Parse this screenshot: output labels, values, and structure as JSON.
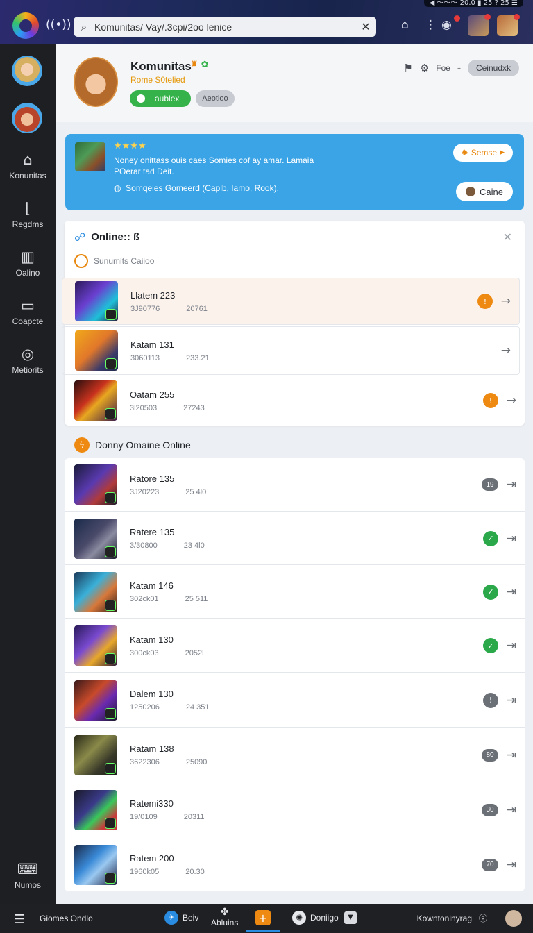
{
  "topbar": {
    "status_text": "◀ 〜〜〜 20.0  ▮  25 ? 25 ☰",
    "search_placeholder": "Komunitas/ Vay/.3cpi/2oo lenice",
    "search_value": "Komunitas/ Vay/.3cpi/2oo lenice"
  },
  "rail": {
    "items": [
      {
        "label": "Konunitas",
        "icon": "home-icon"
      },
      {
        "label": "Regdms",
        "icon": "chart-icon"
      },
      {
        "label": "Oalino",
        "icon": "grid-icon"
      },
      {
        "label": "Coapcte",
        "icon": "calendar-icon"
      },
      {
        "label": "Metiorits",
        "icon": "target-icon"
      }
    ],
    "bottom_label": "Numos"
  },
  "profile": {
    "name": "Komunitas",
    "subtitle": "Rome S0telied",
    "green_pill": "aublex",
    "grey_pill": "Aeotioo",
    "action_text": "Foe",
    "action_chip": "Ceinudxk"
  },
  "banner": {
    "line1": "Noney onittass ouis caes Somies cof ay amar. Lamaia",
    "line2": "POerar tad Deit.",
    "line3": "Somqeies Gomeerd (Caplb, Iamo, Rook),",
    "button1": "Semse",
    "button2": "Caine"
  },
  "online_card": {
    "title": "Online:: ß",
    "subtitle": "Sunumits Caiioo",
    "rows": [
      {
        "name": "Llatem 223",
        "meta1": "3J90776",
        "meta2": "20761",
        "status": "!",
        "status_type": "orange"
      },
      {
        "name": "Katam 131",
        "meta1": "3060113",
        "meta2": "233.21",
        "status": "",
        "status_type": "none"
      },
      {
        "name": "Oatam 255",
        "meta1": "3l20503",
        "meta2": "27243",
        "status": "!",
        "status_type": "orange"
      }
    ]
  },
  "section": {
    "title": "Donny Omaine Online"
  },
  "list": {
    "rows": [
      {
        "name": "Ratore 135",
        "meta1": "3J20223",
        "meta2": "25 4l0",
        "status": "19",
        "status_type": "pill"
      },
      {
        "name": "Ratere 135",
        "meta1": "3/30800",
        "meta2": "23 4l0",
        "status": "✓",
        "status_type": "green"
      },
      {
        "name": "Katam 146",
        "meta1": "302ck01",
        "meta2": "25 511",
        "status": "✓",
        "status_type": "green"
      },
      {
        "name": "Katam 130",
        "meta1": "300ck03",
        "meta2": "2052l",
        "status": "✓",
        "status_type": "green"
      },
      {
        "name": "Dalem 130",
        "meta1": "1250206",
        "meta2": "24 351",
        "status": "!",
        "status_type": "grey"
      },
      {
        "name": "Ratam 138",
        "meta1": "3622306",
        "meta2": "25090",
        "status": "80",
        "status_type": "pill"
      },
      {
        "name": "Ratemi330",
        "meta1": "19/0109",
        "meta2": "20311",
        "status": "30",
        "status_type": "pill"
      },
      {
        "name": "Ratem 200",
        "meta1": "1960k05",
        "meta2": "20.30",
        "status": "70",
        "status_type": "pill"
      }
    ]
  },
  "bottombar": {
    "left_label": "Giomes Ondlo",
    "b1": "Beiv",
    "b2": "Abluins",
    "b3": "Doniigo",
    "right_label": "Kowntonlnyrag"
  },
  "colors": {
    "accent_blue": "#3aa4e6",
    "accent_orange": "#ee8a12",
    "accent_green": "#2aa84a",
    "rail_bg": "#1e1f22"
  }
}
